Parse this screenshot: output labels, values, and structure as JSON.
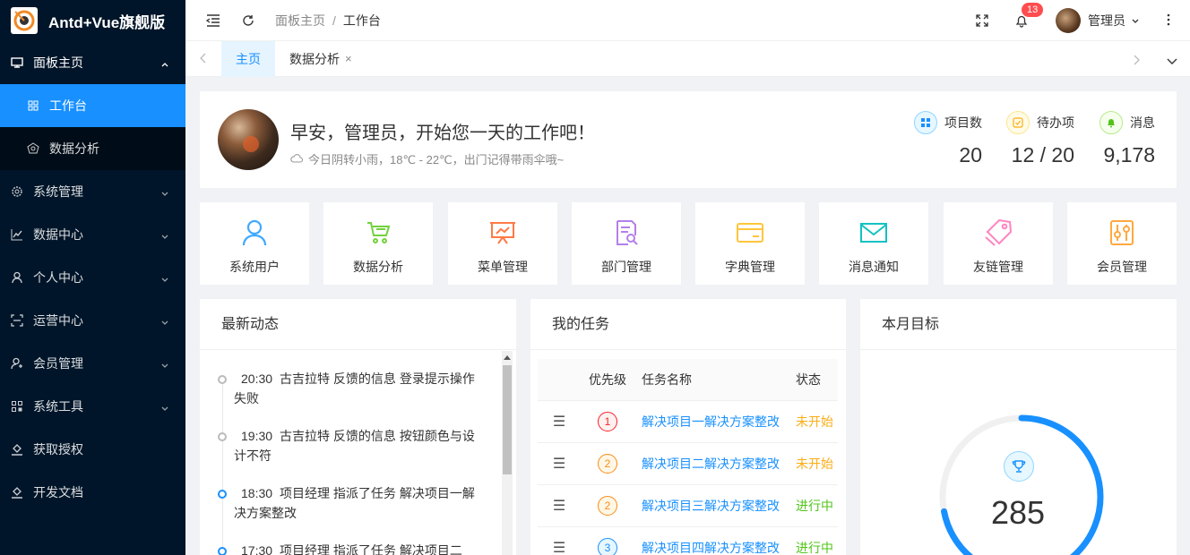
{
  "app": {
    "title": "Antd+Vue旗舰版"
  },
  "sidebar": {
    "items": [
      {
        "label": "面板主页",
        "icon": "monitor-icon",
        "open": true
      },
      {
        "label": "工作台",
        "icon": "dashboard-icon",
        "active": true
      },
      {
        "label": "数据分析",
        "icon": "analysis-icon"
      },
      {
        "label": "系统管理",
        "icon": "gear-icon"
      },
      {
        "label": "数据中心",
        "icon": "chart-icon"
      },
      {
        "label": "个人中心",
        "icon": "user-icon"
      },
      {
        "label": "运营中心",
        "icon": "scan-icon"
      },
      {
        "label": "会员管理",
        "icon": "member-icon"
      },
      {
        "label": "系统工具",
        "icon": "tools-icon"
      },
      {
        "label": "获取授权",
        "icon": "auth-icon"
      },
      {
        "label": "开发文档",
        "icon": "docs-icon"
      }
    ]
  },
  "header": {
    "breadcrumb": [
      "面板主页",
      "工作台"
    ],
    "separator": "/",
    "notification_count": "13",
    "user": "管理员"
  },
  "tabs": [
    {
      "label": "主页",
      "active": true
    },
    {
      "label": "数据分析",
      "closable": true,
      "close_glyph": "×"
    }
  ],
  "welcome": {
    "greeting": "早安，管理员，开始您一天的工作吧！",
    "weather": "今日阴转小雨，18℃ - 22℃，出门记得带雨伞哦~",
    "stats": [
      {
        "label": "项目数",
        "value": "20",
        "color": "#1890ff"
      },
      {
        "label": "待办项",
        "value": "12 / 20",
        "color": "#faad14"
      },
      {
        "label": "消息",
        "value": "9,178",
        "color": "#52c41a"
      }
    ]
  },
  "shortcuts": [
    {
      "label": "系统用户",
      "icon": "user-icon",
      "color": "#40a9ff"
    },
    {
      "label": "数据分析",
      "icon": "cart-icon",
      "color": "#73d13d"
    },
    {
      "label": "菜单管理",
      "icon": "presentation-icon",
      "color": "#ff7a45"
    },
    {
      "label": "部门管理",
      "icon": "document-search-icon",
      "color": "#b37feb"
    },
    {
      "label": "字典管理",
      "icon": "card-icon",
      "color": "#ffc53d"
    },
    {
      "label": "消息通知",
      "icon": "mail-icon",
      "color": "#13c2c2"
    },
    {
      "label": "友链管理",
      "icon": "tag-icon",
      "color": "#ff85c0"
    },
    {
      "label": "会员管理",
      "icon": "slider-icon",
      "color": "#ffa940"
    }
  ],
  "activity": {
    "title": "最新动态",
    "items": [
      {
        "time": "20:30",
        "text": "古吉拉特 反馈的信息 登录提示操作失败",
        "dot": "gray"
      },
      {
        "time": "19:30",
        "text": "古吉拉特 反馈的信息 按钮颜色与设计不符",
        "dot": "gray"
      },
      {
        "time": "18:30",
        "text": "项目经理 指派了任务 解决项目一解决方案整改",
        "dot": "blue"
      },
      {
        "time": "17:30",
        "text": "项目经理 指派了任务 解决项目二",
        "dot": "blue"
      }
    ]
  },
  "tasks": {
    "title": "我的任务",
    "columns": [
      "优先级",
      "任务名称",
      "状态"
    ],
    "rows": [
      {
        "priority": "1",
        "name": "解决项目一解决方案整改",
        "status": "未开始",
        "state": "wait"
      },
      {
        "priority": "2",
        "name": "解决项目二解决方案整改",
        "status": "未开始",
        "state": "wait"
      },
      {
        "priority": "2",
        "name": "解决项目三解决方案整改",
        "status": "进行中",
        "state": "run"
      },
      {
        "priority": "3",
        "name": "解决项目四解决方案整改",
        "status": "进行中",
        "state": "run"
      }
    ]
  },
  "goal": {
    "title": "本月目标",
    "value": "285",
    "progress": 0.72,
    "color": "#1890ff"
  }
}
